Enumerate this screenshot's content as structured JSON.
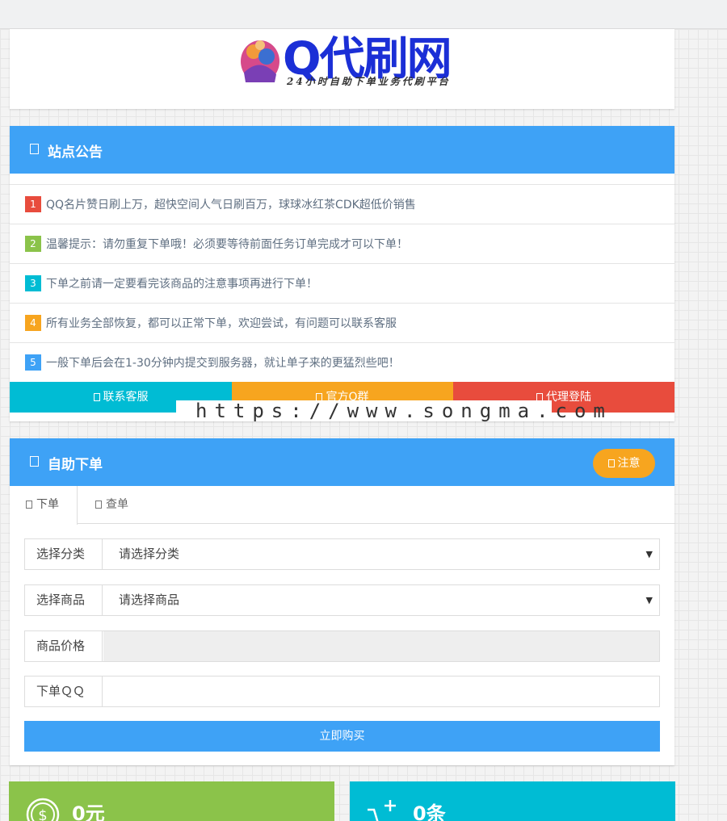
{
  "logo": {
    "title": "Q代刷网",
    "subtitle": "24小时自助下单业务代刷平台"
  },
  "announcement": {
    "title": "站点公告",
    "items": [
      {
        "num": "1",
        "color": "#e84c3d",
        "text": "QQ名片赞日刷上万，超快空间人气日刷百万，球球冰红茶CDK超低价销售"
      },
      {
        "num": "2",
        "color": "#8bc34a",
        "text": "温馨提示：请勿重复下单哦！必须要等待前面任务订单完成才可以下单！"
      },
      {
        "num": "3",
        "color": "#00bcd4",
        "text": "下单之前请一定要看完该商品的注意事项再进行下单！"
      },
      {
        "num": "4",
        "color": "#f7a51f",
        "text": "所有业务全部恢复，都可以正常下单，欢迎尝试，有问题可以联系客服"
      },
      {
        "num": "5",
        "color": "#3ea2f6",
        "text": "一般下单后会在1-30分钟内提交到服务器，就让单子来的更猛烈些吧！"
      }
    ],
    "buttons": [
      {
        "label": "联系客服",
        "color": "#00bcd4"
      },
      {
        "label": "官方Q群",
        "color": "#f7a51f"
      },
      {
        "label": "代理登陆",
        "color": "#e84c3d"
      }
    ]
  },
  "watermark": "https://www.songma.com",
  "order": {
    "title": "自助下单",
    "notice_label": "注意",
    "tabs": [
      "下单",
      "查单"
    ],
    "fields": {
      "category_label": "选择分类",
      "category_value": "请选择分类",
      "product_label": "选择商品",
      "product_value": "请选择商品",
      "price_label": "商品价格",
      "qq_label": "下单ＱＱ"
    },
    "buy_label": "立即购买"
  },
  "stats": [
    {
      "value": "0元",
      "icon": "dollar-coin-icon"
    },
    {
      "value": "0条",
      "icon": "cart-add-icon"
    }
  ]
}
